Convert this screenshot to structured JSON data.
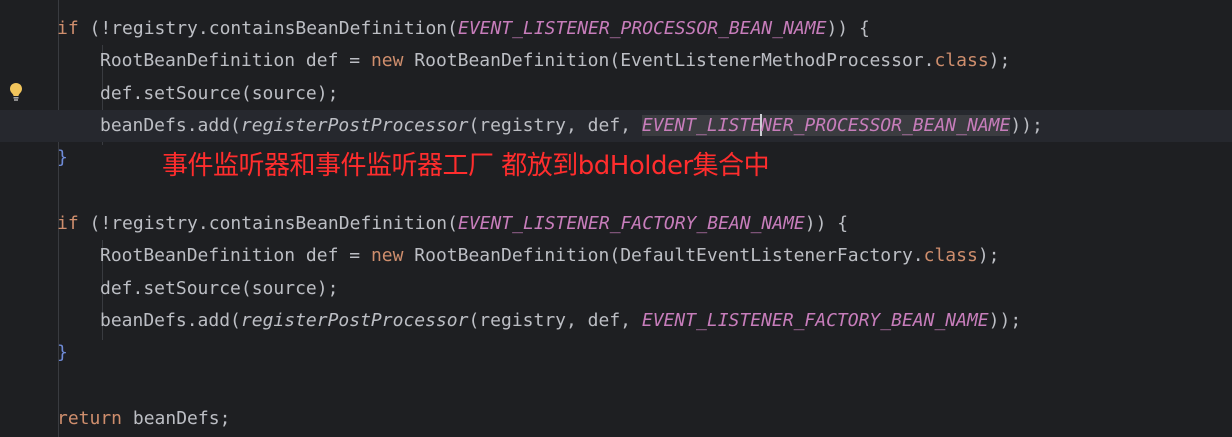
{
  "code": {
    "block1": {
      "if_kw": "if",
      "if_cond_start": " (!registry.containsBeanDefinition(",
      "if_const": "EVENT_LISTENER_PROCESSOR_BEAN_NAME",
      "if_cond_end": ")) {",
      "l2_type": "RootBeanDefinition def = ",
      "l2_new": "new",
      "l2_ctor": " RootBeanDefinition(EventListenerMethodProcessor.",
      "l2_class": "class",
      "l2_end": ");",
      "l3": "def.setSource(source);",
      "l4_start": "beanDefs.add(",
      "l4_fn": "registerPostProcessor",
      "l4_args": "(registry, def, ",
      "l4_const_a": "EVENT_LISTE",
      "l4_const_b": "NER_PROCESSOR_BEAN_NAME",
      "l4_end": "));",
      "close": "}"
    },
    "block2": {
      "if_kw": "if",
      "if_cond_start": " (!registry.containsBeanDefinition(",
      "if_const": "EVENT_LISTENER_FACTORY_BEAN_NAME",
      "if_cond_end": ")) {",
      "l2_type": "RootBeanDefinition def = ",
      "l2_new": "new",
      "l2_ctor": " RootBeanDefinition(DefaultEventListenerFactory.",
      "l2_class": "class",
      "l2_end": ");",
      "l3": "def.setSource(source);",
      "l4_start": "beanDefs.add(",
      "l4_fn": "registerPostProcessor",
      "l4_args": "(registry, def, ",
      "l4_const": "EVENT_LISTENER_FACTORY_BEAN_NAME",
      "l4_end": "));",
      "close": "}"
    },
    "return_kw": "return",
    "return_rest": " beanDefs;"
  },
  "annotation": "事件监听器和事件监听器工厂 都放到bdHolder集合中",
  "gutter": {
    "intention_icon": "lightbulb-icon"
  },
  "colors": {
    "background": "#1e1f22",
    "keyword": "#cf8e6d",
    "constant": "#c77dbb",
    "annotation": "#ff2d2d"
  }
}
